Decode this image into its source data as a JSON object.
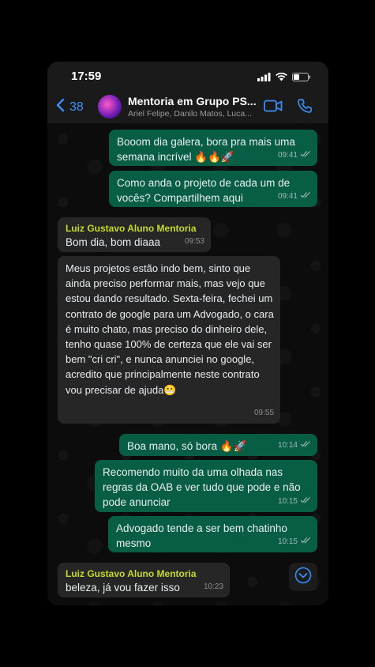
{
  "status_bar": {
    "time": "17:59"
  },
  "header": {
    "back_count": "38",
    "group_name": "Mentoria em Grupo PS...",
    "members": "Ariel Felipe, Danilo Matos, Luca..."
  },
  "messages": [
    {
      "dir": "out",
      "text": "Booom dia galera, bora pra mais uma semana incrível 🔥🔥🚀",
      "time": "09:41"
    },
    {
      "dir": "out",
      "text": "Como anda o projeto de cada um de vocês? Compartilhem aqui",
      "time": "09:41"
    },
    {
      "dir": "in",
      "sender": "Luiz Gustavo Aluno Mentoria",
      "text": "Bom dia, bom diaaa",
      "time": "09:53"
    },
    {
      "dir": "in",
      "text": "Meus projetos estão indo bem, sinto que ainda preciso performar mais, mas vejo que estou dando resultado. Sexta-feira, fechei um contrato de google para um Advogado, o cara é muito chato, mas preciso do dinheiro dele, tenho quase 100% de certeza que ele vai ser bem \"cri cri\", e nunca anunciei no google, acredito que principalmente neste contrato vou precisar de ajuda😬",
      "time": "09:55"
    },
    {
      "dir": "out",
      "text": "Boa mano, só bora 🔥🚀",
      "time": "10:14"
    },
    {
      "dir": "out",
      "text": "Recomendo muito da uma olhada nas regras da OAB e ver tudo que pode e não pode anunciar",
      "time": "10:15"
    },
    {
      "dir": "out",
      "text": "Advogado tende a ser bem chatinho mesmo",
      "time": "10:15"
    },
    {
      "dir": "in",
      "sender": "Luiz Gustavo Aluno Mentoria",
      "text": "beleza, já vou fazer isso",
      "time": "10:23"
    }
  ],
  "colors": {
    "outgoing_bubble": "#075e45",
    "incoming_bubble": "#262626",
    "accent": "#3a8ef6",
    "sender_name": "#c7d926"
  }
}
